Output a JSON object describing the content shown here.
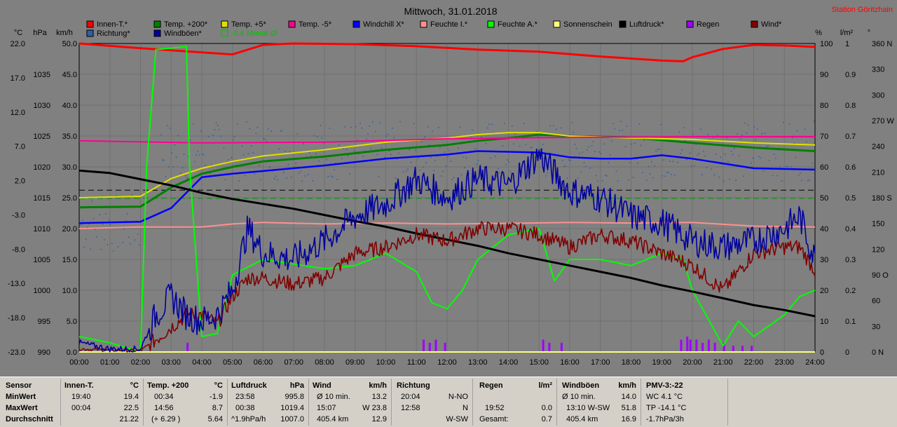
{
  "chart_data": {
    "type": "line",
    "title": "Mittwoch, 31.01.2018",
    "station": "Station Göritzhain",
    "x_ticks": [
      "00:00",
      "01:00",
      "02:00",
      "03:00",
      "04:00",
      "05:00",
      "06:00",
      "07:00",
      "08:00",
      "09:00",
      "10:00",
      "11:00",
      "12:00",
      "13:00",
      "14:00",
      "15:00",
      "16:00",
      "17:00",
      "18:00",
      "19:00",
      "20:00",
      "21:00",
      "22:00",
      "23:00",
      "24:00"
    ],
    "axes": {
      "temp": {
        "unit": "°C",
        "ticks": [
          "22.0",
          "17.0",
          "12.0",
          "7.0",
          "2.0",
          "-3.0",
          "-8.0",
          "-13.0",
          "-18.0",
          "-23.0"
        ],
        "range": [
          -23,
          22
        ]
      },
      "pressure": {
        "unit": "hPa",
        "ticks": [
          "1035",
          "1030",
          "1025",
          "1020",
          "1015",
          "1010",
          "1005",
          "1000",
          "995",
          "990"
        ],
        "range": [
          990,
          1040
        ]
      },
      "wind": {
        "unit": "km/h",
        "ticks": [
          "50.0",
          "45.0",
          "40.0",
          "35.0",
          "30.0",
          "25.0",
          "20.0",
          "15.0",
          "10.0",
          "5.0",
          "0.0"
        ],
        "range": [
          0,
          50
        ]
      },
      "humidity": {
        "unit": "%",
        "ticks": [
          "100",
          "90",
          "80",
          "70",
          "60",
          "50",
          "40",
          "30",
          "20",
          "10",
          "0"
        ],
        "range": [
          0,
          100
        ]
      },
      "rain": {
        "unit": "l/m²",
        "ticks": [
          "1",
          "0.9",
          "0.8",
          "0.7",
          "0.6",
          "0.5",
          "0.4",
          "0.3",
          "0.2",
          "0.1",
          "0"
        ],
        "range": [
          0,
          1
        ]
      },
      "direction": {
        "unit": "°",
        "ticks": [
          "360 N",
          "330",
          "300",
          "270 W",
          "240",
          "210",
          "180 S",
          "150",
          "120",
          "90 O",
          "60",
          "30",
          "0 N"
        ],
        "range": [
          0,
          360
        ]
      }
    },
    "legend": [
      {
        "name": "Innen-T.*",
        "color": "#ff0000"
      },
      {
        "name": "Temp. +200*",
        "color": "#008000"
      },
      {
        "name": "Temp. +5*",
        "color": "#e0e000"
      },
      {
        "name": "Temp. -5*",
        "color": "#ff0090"
      },
      {
        "name": "Windchill X*",
        "color": "#0000ff"
      },
      {
        "name": "Feuchte I.*",
        "color": "#ff9090"
      },
      {
        "name": "Feuchte A.*",
        "color": "#00ff00"
      },
      {
        "name": "Sonnenschein",
        "color": "#ffff80"
      },
      {
        "name": "Luftdruck*",
        "color": "#000000"
      },
      {
        "name": "Regen",
        "color": "#a000ff"
      },
      {
        "name": "Wind*",
        "color": "#800000"
      },
      {
        "name": "Richtung*",
        "color": "#3060a0"
      },
      {
        "name": "Windböen*",
        "color": "#0000a0"
      },
      {
        "name": "-0.6 Monat-Ø",
        "color": "#00c000"
      }
    ],
    "series": [
      {
        "name": "Innen-T.*",
        "axis": "temp",
        "x": [
          0,
          2,
          4,
          5,
          6,
          7,
          9,
          11,
          13,
          15,
          17,
          18,
          19,
          19.7,
          20,
          21,
          22,
          23,
          24
        ],
        "y": [
          22.0,
          21.3,
          20.7,
          20.4,
          21.8,
          22.0,
          21.9,
          21.6,
          21.1,
          20.8,
          20.1,
          19.8,
          19.5,
          19.4,
          20.0,
          21.2,
          21.8,
          21.7,
          21.5
        ]
      },
      {
        "name": "Temp. +200*",
        "axis": "temp",
        "x": [
          0,
          2,
          3,
          4,
          5,
          6,
          8,
          10,
          12,
          13,
          14,
          15,
          16,
          18,
          20,
          22,
          24
        ],
        "y": [
          -1.9,
          -1.8,
          1.0,
          3.0,
          4.0,
          4.8,
          5.5,
          6.5,
          7.2,
          7.8,
          8.2,
          8.7,
          8.5,
          8.3,
          7.5,
          6.8,
          6.3
        ]
      },
      {
        "name": "Temp. +5*",
        "axis": "temp",
        "x": [
          0,
          2,
          3,
          4,
          5,
          6,
          8,
          10,
          12,
          13,
          14,
          15,
          16,
          18,
          20,
          22,
          24
        ],
        "y": [
          -0.5,
          -0.3,
          2.3,
          3.8,
          4.8,
          5.6,
          6.5,
          7.6,
          8.2,
          8.7,
          9.0,
          9.0,
          8.5,
          8.2,
          8.0,
          7.5,
          7.2
        ]
      },
      {
        "name": "Temp. -5*",
        "axis": "temp",
        "x": [
          0,
          4,
          8,
          12,
          14,
          16,
          20,
          24
        ],
        "y": [
          7.8,
          7.5,
          7.6,
          8.1,
          8.2,
          8.3,
          8.4,
          8.4
        ]
      },
      {
        "name": "Windchill X*",
        "axis": "temp",
        "x": [
          0,
          2,
          3,
          4,
          5,
          6,
          8,
          10,
          12,
          13,
          14,
          15,
          16,
          17,
          18,
          19,
          20,
          22,
          24
        ],
        "y": [
          -4.2,
          -4.0,
          -2.0,
          2.5,
          3.0,
          3.4,
          4.2,
          5.2,
          5.8,
          6.3,
          6.2,
          6.1,
          5.4,
          5.2,
          5.2,
          5.7,
          5.2,
          3.8,
          3.6
        ]
      },
      {
        "name": "Feuchte I.*",
        "axis": "humidity",
        "x": [
          0,
          2,
          4,
          5,
          6,
          8,
          10,
          12,
          14,
          16,
          18,
          20,
          22,
          24
        ],
        "y": [
          40.0,
          40.5,
          40.5,
          41.5,
          42.0,
          41.5,
          41.8,
          41.5,
          41.7,
          42.0,
          41.8,
          42.0,
          40.8,
          40.5
        ]
      },
      {
        "name": "Feuchte A.*",
        "axis": "humidity",
        "x": [
          0,
          1,
          2,
          2.2,
          2.5,
          3.5,
          3.6,
          4.0,
          4.5,
          5.0,
          6.0,
          8.0,
          9.0,
          10.0,
          11.0,
          11.5,
          12.0,
          12.5,
          13.0,
          14.0,
          15.0,
          15.5,
          16.0,
          17.0,
          18.0,
          19.0,
          19.7,
          20.0,
          21.0,
          21.5,
          22.0,
          23.0,
          23.5,
          24.0
        ],
        "y": [
          5,
          3,
          0,
          60,
          98,
          99,
          60,
          5,
          6,
          25,
          30,
          27,
          28,
          32,
          26,
          16,
          14,
          20,
          30,
          38,
          40,
          23,
          30,
          30,
          28,
          32,
          30,
          20,
          2,
          10,
          5,
          12,
          18,
          20
        ]
      },
      {
        "name": "Sonnenschein",
        "axis": "humidity",
        "x": [
          0,
          24
        ],
        "y": [
          0,
          0
        ]
      },
      {
        "name": "Luftdruck*",
        "axis": "pressure",
        "x": [
          0,
          1,
          2,
          3,
          4,
          5,
          6,
          7,
          8,
          9,
          10,
          11,
          12,
          13,
          14,
          15,
          16,
          17,
          18,
          19,
          20,
          21,
          22,
          23,
          24
        ],
        "y": [
          1019.4,
          1019.0,
          1018.0,
          1017.0,
          1015.8,
          1014.8,
          1014.0,
          1013.2,
          1012.2,
          1011.2,
          1010.3,
          1009.2,
          1008.2,
          1007.2,
          1006.0,
          1005.0,
          1004.0,
          1003.0,
          1002.0,
          1000.8,
          999.8,
          998.7,
          997.6,
          996.8,
          995.8
        ]
      },
      {
        "name": "Wind*",
        "axis": "wind",
        "x": [
          0,
          1,
          2,
          2.5,
          3,
          3.5,
          4,
          4.5,
          5,
          5.5,
          6,
          7,
          8,
          9,
          10,
          11,
          12,
          13,
          14,
          15,
          16,
          17,
          18,
          19,
          20,
          21,
          22,
          23,
          23.5,
          24
        ],
        "y": [
          0.5,
          0.3,
          0.2,
          2,
          4,
          6,
          6,
          4.5,
          9,
          12,
          12,
          11,
          12,
          16,
          17,
          19,
          18,
          20,
          20,
          19,
          17,
          19,
          18,
          16,
          14,
          10,
          16,
          17,
          17,
          13.2
        ]
      },
      {
        "name": "Windböen*",
        "axis": "wind",
        "x": [
          0,
          1,
          2,
          2.5,
          3,
          3.5,
          4,
          4.5,
          5,
          5.5,
          6,
          7,
          8,
          9,
          10,
          11,
          12,
          13,
          14,
          15,
          16,
          17,
          18,
          19,
          20,
          21,
          22,
          23,
          23.5,
          24
        ],
        "y": [
          1.5,
          0.5,
          0.5,
          6,
          9,
          6,
          5,
          6,
          10,
          20,
          16,
          15,
          18,
          22,
          24,
          28,
          25,
          28,
          27,
          32,
          26,
          25,
          22,
          21,
          18,
          17,
          18,
          20,
          22,
          15
        ]
      },
      {
        "name": "-0.6 Monat-Ø",
        "axis": "temp",
        "x": [
          0,
          24
        ],
        "y": [
          -0.6,
          -0.6
        ]
      }
    ],
    "reference_lines": {
      "black_dashed_temp": 0.6,
      "green_dashed_temp": -0.6
    },
    "grid": true,
    "legend_placement": "top"
  },
  "stats": {
    "sensor": {
      "header": "Sensor",
      "rows": [
        "MinWert",
        "MaxWert",
        "Durchschnitt"
      ]
    },
    "innen": {
      "header": "Innen-T.",
      "unit": "°C",
      "rows": [
        [
          "19:40",
          "19.4"
        ],
        [
          "00:04",
          "22.5"
        ],
        [
          "",
          "21.22"
        ]
      ]
    },
    "temp200": {
      "header": "Temp. +200",
      "unit": "°C",
      "rows": [
        [
          "00:34",
          "-1.9"
        ],
        [
          "14:56",
          "8.7"
        ],
        [
          "(+ 6.29 )",
          "5.64"
        ]
      ]
    },
    "luftdruck": {
      "header": "Luftdruck",
      "unit": "hPa",
      "rows": [
        [
          "23:58",
          "995.8"
        ],
        [
          "00:38",
          "1019.4"
        ],
        [
          "^1.9hPa/h",
          "1007.0"
        ]
      ]
    },
    "wind": {
      "header": "Wind",
      "unit": "km/h",
      "rows": [
        [
          "Ø 10 min.",
          "13.2"
        ],
        [
          "15:07",
          "W 23.8"
        ],
        [
          "405.4 km",
          "12.9"
        ]
      ]
    },
    "richtung": {
      "header": "Richtung",
      "rows": [
        [
          "20:04",
          "N-NO"
        ],
        [
          "12:58",
          "N"
        ],
        [
          "",
          "W-SW"
        ]
      ]
    },
    "regen": {
      "header": "Regen",
      "unit": "l/m²",
      "rows": [
        [
          "",
          ""
        ],
        [
          "19:52",
          "0.0"
        ],
        [
          "Gesamt:",
          "0.7"
        ]
      ]
    },
    "windboeen": {
      "header": "Windböen",
      "unit": "km/h",
      "rows": [
        [
          "Ø 10 min.",
          "14.0"
        ],
        [
          "13:10  W-SW",
          "51.8"
        ],
        [
          "405.4 km",
          "16.9"
        ]
      ]
    },
    "pmv": {
      "header": "PMV-3:-22",
      "rows": [
        "WC 4.1 °C",
        "TP -14.1 °C",
        "-1.7hPa/3h"
      ]
    }
  }
}
